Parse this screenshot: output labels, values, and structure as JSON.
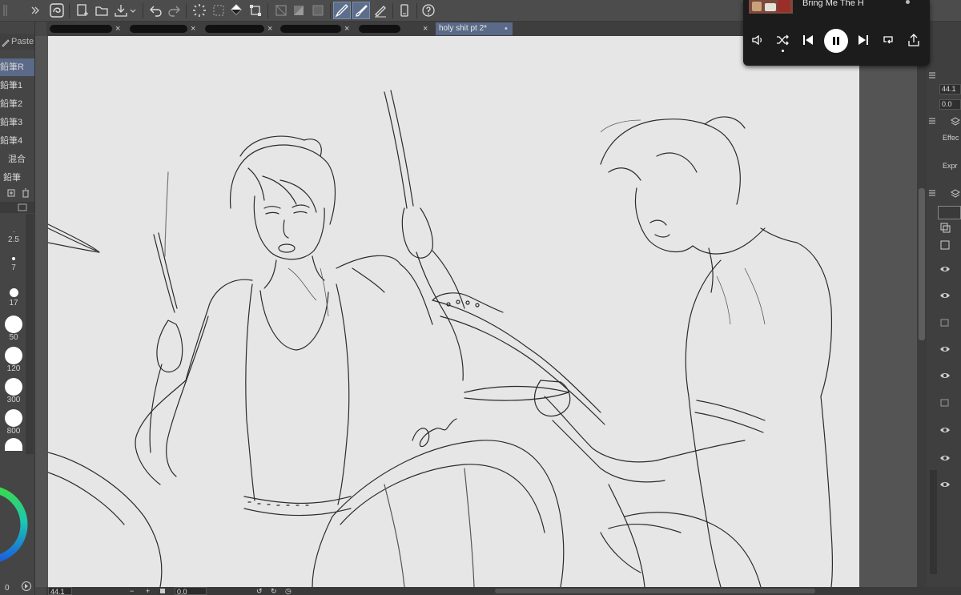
{
  "tabs": {
    "items": [
      {
        "label": "",
        "redacted": true,
        "close": "×"
      },
      {
        "label": "",
        "redacted": true,
        "close": "×"
      },
      {
        "label": "",
        "redacted": true,
        "close": "×"
      },
      {
        "label": "",
        "redacted": true,
        "close": "×"
      },
      {
        "label": "",
        "redacted": true,
        "close": "×"
      },
      {
        "label": "holy shit pt 2*",
        "redacted": false,
        "close": "•"
      }
    ]
  },
  "left_panel": {
    "paste_label": "Paste",
    "sub_tools": [
      "鉛筆R",
      "鉛筆1",
      "鉛筆2",
      "鉛筆3",
      "鉛筆4",
      "混合",
      "鉛筆"
    ],
    "brush_sizes": [
      "2.5",
      "7",
      "17",
      "50",
      "120",
      "300",
      "800"
    ],
    "color_value": "0"
  },
  "right_panel": {
    "value_1": "44.1",
    "value_2": "0.0",
    "label_effect": "Effec",
    "label_expression": "Expr"
  },
  "status_bar": {
    "zoom": "44.1",
    "rotation": "0.0"
  },
  "player": {
    "song_title": "Bring Me The H",
    "controls": [
      "volume-icon",
      "shuffle-icon",
      "previous-icon",
      "pause-icon",
      "next-icon",
      "repeat-icon",
      "share-icon"
    ]
  },
  "colors": {
    "toolbar_bg": "#4c4c4c",
    "panel_bg": "#454545",
    "canvas_paper": "#e6e6e6",
    "accent_selected": "#5a6a88",
    "player_bg": "#1c1c1c",
    "color_wheel_green": "#1cd44a",
    "color_wheel_blue": "#1a8ad8"
  }
}
